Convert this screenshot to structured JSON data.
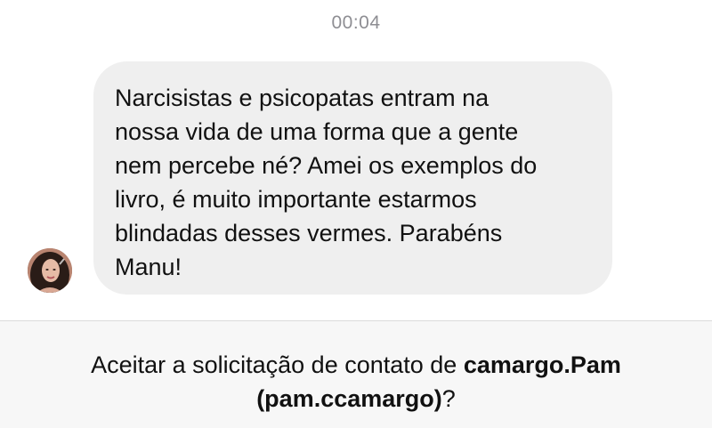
{
  "conversation": {
    "timestamp": "00:04",
    "message": {
      "text": "Narcisistas e psicopatas entram na\nnossa vida de uma forma que a gente\nnem percebe né? Amei os exemplos do\nlivro, é muito importante estarmos\nblindadas desses vermes. Parabéns\nManu!"
    },
    "sender_avatar_icon": "profile-photo-icon"
  },
  "contact_request": {
    "prefix": "Aceitar a solicitação de contato de ",
    "display_name": "camargo.Pam",
    "username": "(pam.ccamargo)",
    "suffix": "?"
  }
}
